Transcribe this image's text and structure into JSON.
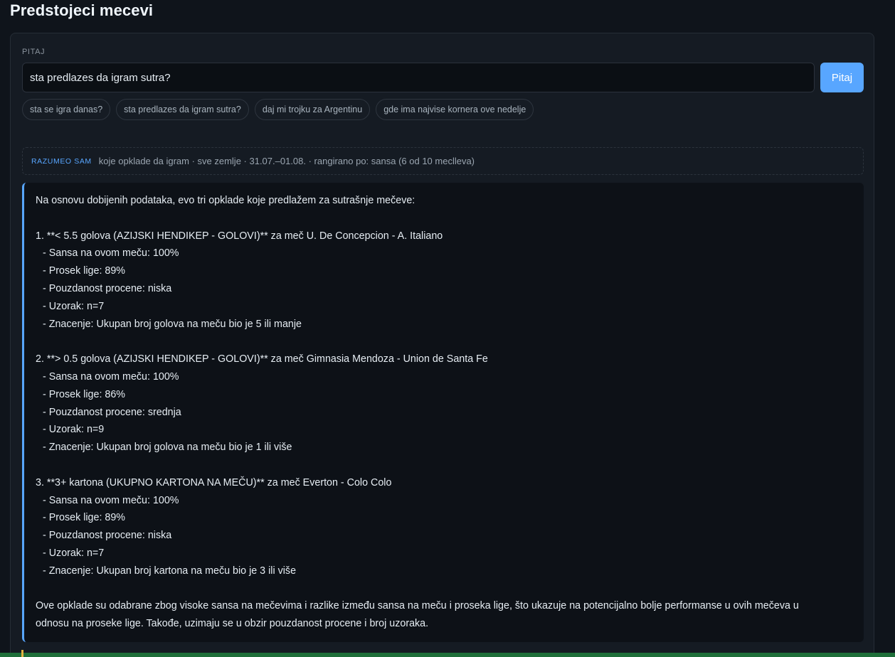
{
  "page": {
    "title": "Predstojeci mecevi"
  },
  "ask": {
    "label": "PITAJ",
    "input_value": "sta predlazes da igram sutra?",
    "button_label": "Pitaj"
  },
  "suggestions": [
    "sta se igra danas?",
    "sta predlazes da igram sutra?",
    "daj mi trojku za Argentinu",
    "gde ima najvise kornera ove nedelje"
  ],
  "understood": {
    "tag": "RAZUMEO SAM",
    "text": "koje opklade da igram · sve zemlje · 31.07.–01.08. · rangirano po: sansa (6 od 10 meclleva)"
  },
  "answer": {
    "intro": "Na osnovu dobijenih podataka, evo tri opklade koje predlažem za sutrašnje mečeve:",
    "bets": [
      {
        "heading": "1. **< 5.5 golova (AZIJSKI HENDIKEP - GOLOVI)** za meč U. De Concepcion - A. Italiano",
        "details": [
          "- Sansa na ovom meču: 100%",
          "- Prosek lige: 89%",
          "- Pouzdanost procene: niska",
          "- Uzorak: n=7",
          "- Znacenje: Ukupan broj golova na meču bio je 5 ili manje"
        ]
      },
      {
        "heading": "2. **> 0.5 golova (AZIJSKI HENDIKEP - GOLOVI)** za meč Gimnasia Mendoza - Union de Santa Fe",
        "details": [
          "- Sansa na ovom meču: 100%",
          "- Prosek lige: 86%",
          "- Pouzdanost procene: srednja",
          "- Uzorak: n=9",
          "- Znacenje: Ukupan broj golova na meču bio je 1 ili više"
        ]
      },
      {
        "heading": "3. **3+ kartona (UKUPNO KARTONA NA MEČU)** za meč Everton - Colo Colo",
        "details": [
          "- Sansa na ovom meču: 100%",
          "- Prosek lige: 89%",
          "- Pouzdanost procene: niska",
          "- Uzorak: n=7",
          "- Znacenje: Ukupan broj kartona na meču bio je 3 ili više"
        ]
      }
    ],
    "conclusion_1": "Ove opklade su odabrane zbog visoke sansa na mečevima i razlike između sansa na meču i proseka lige, što ukazuje na potencijalno bolje performanse u ovih mečeva u",
    "conclusion_2": "odnosu na proseke lige. Takođe, uzimaju se u obzir pouzdanost procene i broj uzoraka."
  },
  "colors": {
    "accent": "#58a6ff",
    "background": "#0f141b",
    "card": "#151b23",
    "answer_bg": "#0d1117"
  }
}
